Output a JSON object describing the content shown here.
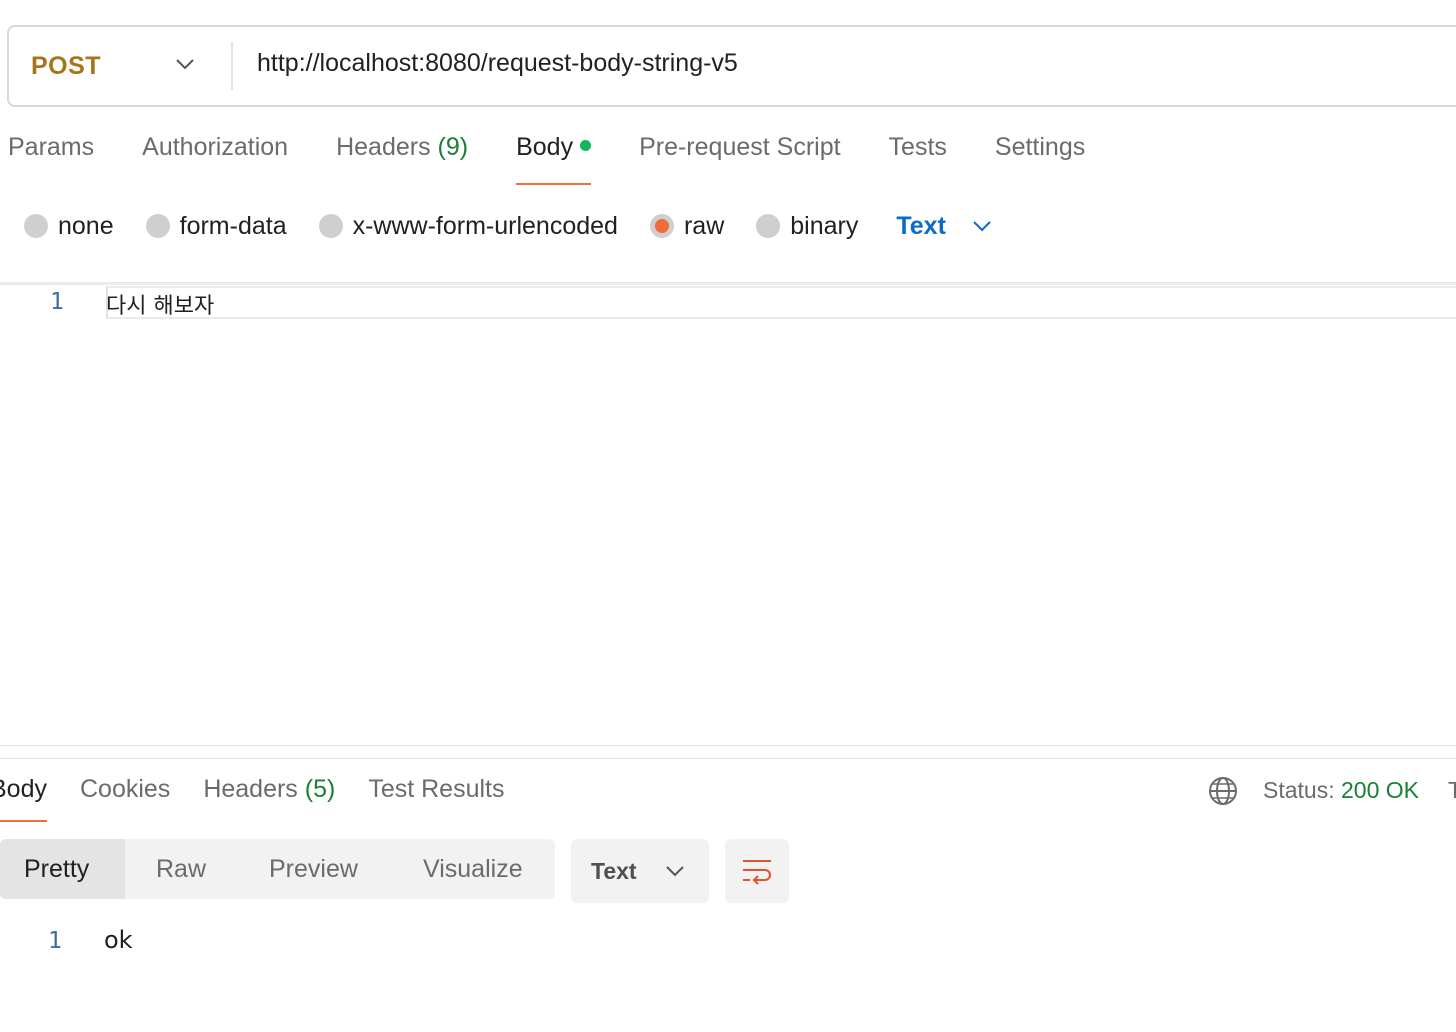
{
  "request": {
    "method": "POST",
    "url": "http://localhost:8080/request-body-string-v5"
  },
  "request_tabs": [
    {
      "label": "Params",
      "count": ""
    },
    {
      "label": "Authorization",
      "count": ""
    },
    {
      "label": "Headers",
      "count": "(9)"
    },
    {
      "label": "Body",
      "count": ""
    },
    {
      "label": "Pre-request Script",
      "count": ""
    },
    {
      "label": "Tests",
      "count": ""
    },
    {
      "label": "Settings",
      "count": ""
    }
  ],
  "body_types": {
    "none": "none",
    "form_data": "form-data",
    "urlencoded": "x-www-form-urlencoded",
    "raw": "raw",
    "binary": "binary",
    "selected": "raw",
    "format": "Text"
  },
  "editor": {
    "line_number": "1",
    "content": "다시 해보자"
  },
  "response_tabs": [
    {
      "label": "Body",
      "count": ""
    },
    {
      "label": "Cookies",
      "count": ""
    },
    {
      "label": "Headers",
      "count": "(5)"
    },
    {
      "label": "Test Results",
      "count": ""
    }
  ],
  "status": {
    "label": "Status:",
    "value": "200 OK",
    "tail": "T"
  },
  "view_modes": {
    "pretty": "Pretty",
    "raw": "Raw",
    "preview": "Preview",
    "visualize": "Visualize"
  },
  "response_format": "Text",
  "response_body": {
    "line_number": "1",
    "content": "ok"
  },
  "colors": {
    "accent": "#f26b3a",
    "method": "#a8741a",
    "success": "#1a7f37",
    "link": "#0b6bcb"
  }
}
